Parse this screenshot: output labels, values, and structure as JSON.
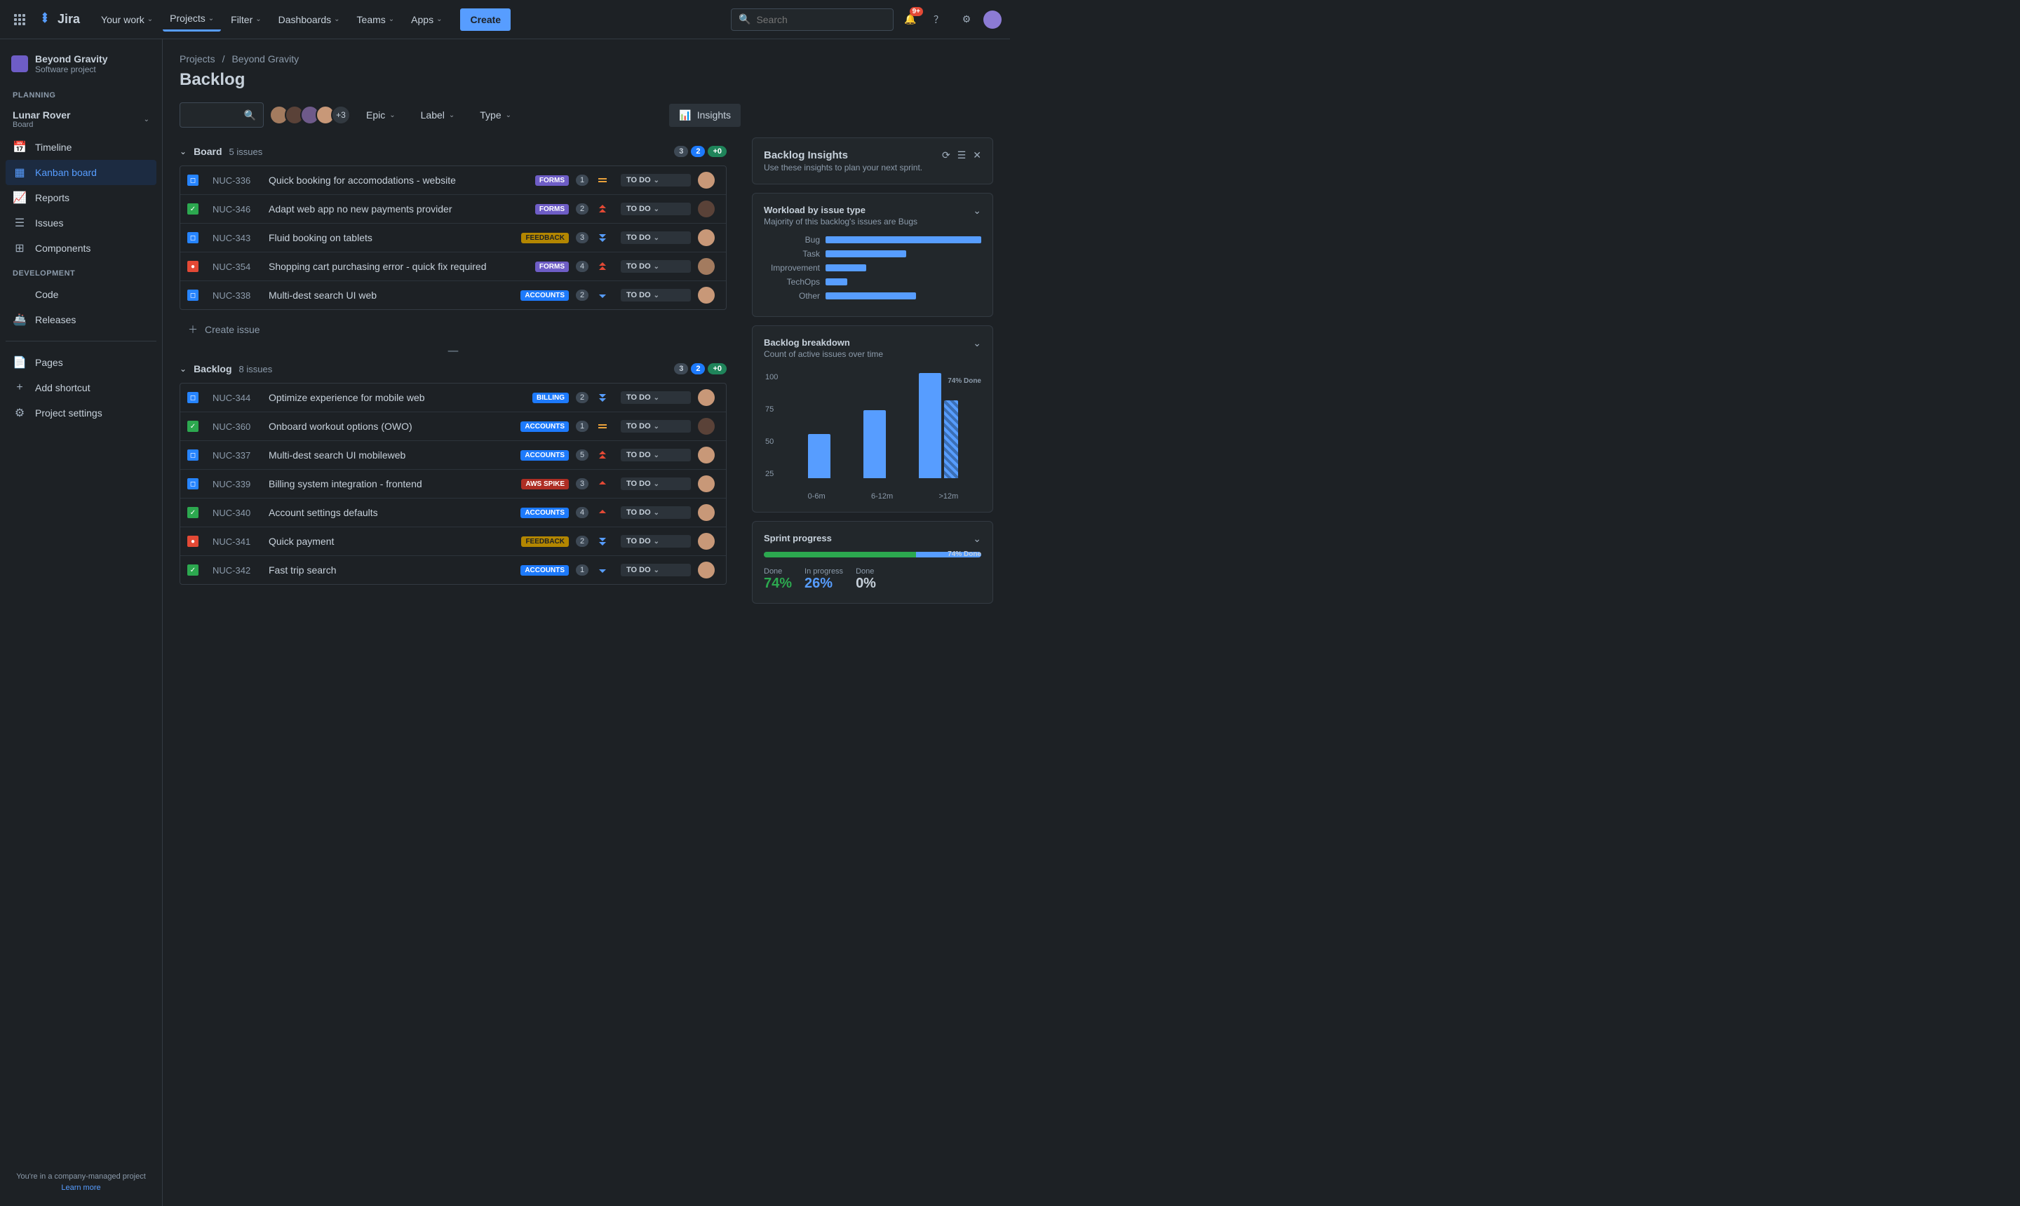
{
  "topnav": {
    "logo": "Jira",
    "items": [
      "Your work",
      "Projects",
      "Filter",
      "Dashboards",
      "Teams",
      "Apps"
    ],
    "active_index": 1,
    "create": "Create",
    "search_placeholder": "Search",
    "notification_badge": "9+"
  },
  "sidebar": {
    "project_name": "Beyond Gravity",
    "project_type": "Software project",
    "planning_label": "PLANNING",
    "board_name": "Lunar Rover",
    "board_sub": "Board",
    "planning_items": [
      "Timeline",
      "Kanban board",
      "Reports",
      "Issues",
      "Components"
    ],
    "planning_selected": 1,
    "dev_label": "DEVELOPMENT",
    "dev_items": [
      "Code",
      "Releases"
    ],
    "bottom_items": [
      "Pages",
      "Add shortcut",
      "Project settings"
    ],
    "footer_text": "You're in a company-managed project",
    "footer_link": "Learn more"
  },
  "breadcrumb": [
    "Projects",
    "Beyond Gravity"
  ],
  "page_title": "Backlog",
  "toolbar": {
    "avatar_overflow": "+3",
    "filters": [
      "Epic",
      "Label",
      "Type"
    ],
    "insights": "Insights"
  },
  "groups": [
    {
      "name": "Board",
      "count_text": "5 issues",
      "pills": [
        "3",
        "2",
        "+0"
      ],
      "issues": [
        {
          "type": "story",
          "key": "NUC-336",
          "summary": "Quick booking for accomodations - website",
          "tag": "FORMS",
          "tag_cls": "purple",
          "est": "1",
          "prio": "medium",
          "status": "TO DO",
          "av": "a4"
        },
        {
          "type": "task",
          "key": "NUC-346",
          "summary": "Adapt web app no new payments provider",
          "tag": "FORMS",
          "tag_cls": "purple",
          "est": "2",
          "prio": "highest",
          "status": "TO DO",
          "av": "a2"
        },
        {
          "type": "story",
          "key": "NUC-343",
          "summary": "Fluid booking on tablets",
          "tag": "FEEDBACK",
          "tag_cls": "yellow",
          "est": "3",
          "prio": "lowest",
          "status": "TO DO",
          "av": "a4"
        },
        {
          "type": "bug",
          "key": "NUC-354",
          "summary": "Shopping cart purchasing error - quick fix required",
          "tag": "FORMS",
          "tag_cls": "purple",
          "est": "4",
          "prio": "highest",
          "status": "TO DO",
          "av": "a1"
        },
        {
          "type": "story",
          "key": "NUC-338",
          "summary": "Multi-dest search UI web",
          "tag": "ACCOUNTS",
          "tag_cls": "blue",
          "est": "2",
          "prio": "low",
          "status": "TO DO",
          "av": "a4"
        }
      ],
      "create_text": "Create issue"
    },
    {
      "name": "Backlog",
      "count_text": "8 issues",
      "pills": [
        "3",
        "2",
        "+0"
      ],
      "issues": [
        {
          "type": "story",
          "key": "NUC-344",
          "summary": "Optimize experience for mobile web",
          "tag": "BILLING",
          "tag_cls": "blue",
          "est": "2",
          "prio": "lowest",
          "status": "TO DO",
          "av": "a4"
        },
        {
          "type": "task",
          "key": "NUC-360",
          "summary": "Onboard workout options (OWO)",
          "tag": "ACCOUNTS",
          "tag_cls": "blue",
          "est": "1",
          "prio": "medium",
          "status": "TO DO",
          "av": "a2"
        },
        {
          "type": "story",
          "key": "NUC-337",
          "summary": "Multi-dest search UI mobileweb",
          "tag": "ACCOUNTS",
          "tag_cls": "blue",
          "est": "5",
          "prio": "highest",
          "status": "TO DO",
          "av": "a4"
        },
        {
          "type": "story",
          "key": "NUC-339",
          "summary": "Billing system integration - frontend",
          "tag": "AWS SPIKE",
          "tag_cls": "red",
          "est": "3",
          "prio": "high",
          "status": "TO DO",
          "av": "a4"
        },
        {
          "type": "task",
          "key": "NUC-340",
          "summary": "Account settings defaults",
          "tag": "ACCOUNTS",
          "tag_cls": "blue",
          "est": "4",
          "prio": "high",
          "status": "TO DO",
          "av": "a4"
        },
        {
          "type": "bug",
          "key": "NUC-341",
          "summary": "Quick payment",
          "tag": "FEEDBACK",
          "tag_cls": "yellow",
          "est": "2",
          "prio": "lowest",
          "status": "TO DO",
          "av": "a4"
        },
        {
          "type": "task",
          "key": "NUC-342",
          "summary": "Fast trip search",
          "tag": "ACCOUNTS",
          "tag_cls": "blue",
          "est": "1",
          "prio": "low",
          "status": "TO DO",
          "av": "a4"
        }
      ]
    }
  ],
  "insights_panel": {
    "title": "Backlog Insights",
    "subtitle": "Use these insights to plan your next sprint.",
    "workload": {
      "title": "Workload by issue type",
      "sub": "Majority of this backlog's issues are Bugs",
      "rows": [
        {
          "label": "Bug",
          "pct": 100
        },
        {
          "label": "Task",
          "pct": 52
        },
        {
          "label": "Improvement",
          "pct": 26
        },
        {
          "label": "TechOps",
          "pct": 14
        },
        {
          "label": "Other",
          "pct": 58
        }
      ]
    },
    "breakdown": {
      "title": "Backlog breakdown",
      "sub": "Count of active issues over time",
      "done_label": "74% Done"
    },
    "sprint": {
      "title": "Sprint progress",
      "done_pct_label": "74% Done",
      "done_pct": 70,
      "inprog_pct": 30,
      "stats": [
        {
          "label": "Done",
          "val": "74%",
          "cls": "green"
        },
        {
          "label": "In progress",
          "val": "26%",
          "cls": "blue"
        },
        {
          "label": "Done",
          "val": "0%",
          "cls": ""
        }
      ]
    }
  },
  "chart_data": {
    "type": "bar",
    "title": "Backlog breakdown — Count of active issues over time",
    "categories": [
      "0-6m",
      "6-12m",
      ">12m"
    ],
    "series": [
      {
        "name": "Active",
        "values": [
          42,
          65,
          100
        ]
      },
      {
        "name": "Done",
        "values": [
          null,
          null,
          74
        ]
      }
    ],
    "ylabel": "",
    "xlabel": "",
    "ylim": [
      0,
      100
    ],
    "y_ticks": [
      100,
      75,
      50,
      25
    ]
  }
}
